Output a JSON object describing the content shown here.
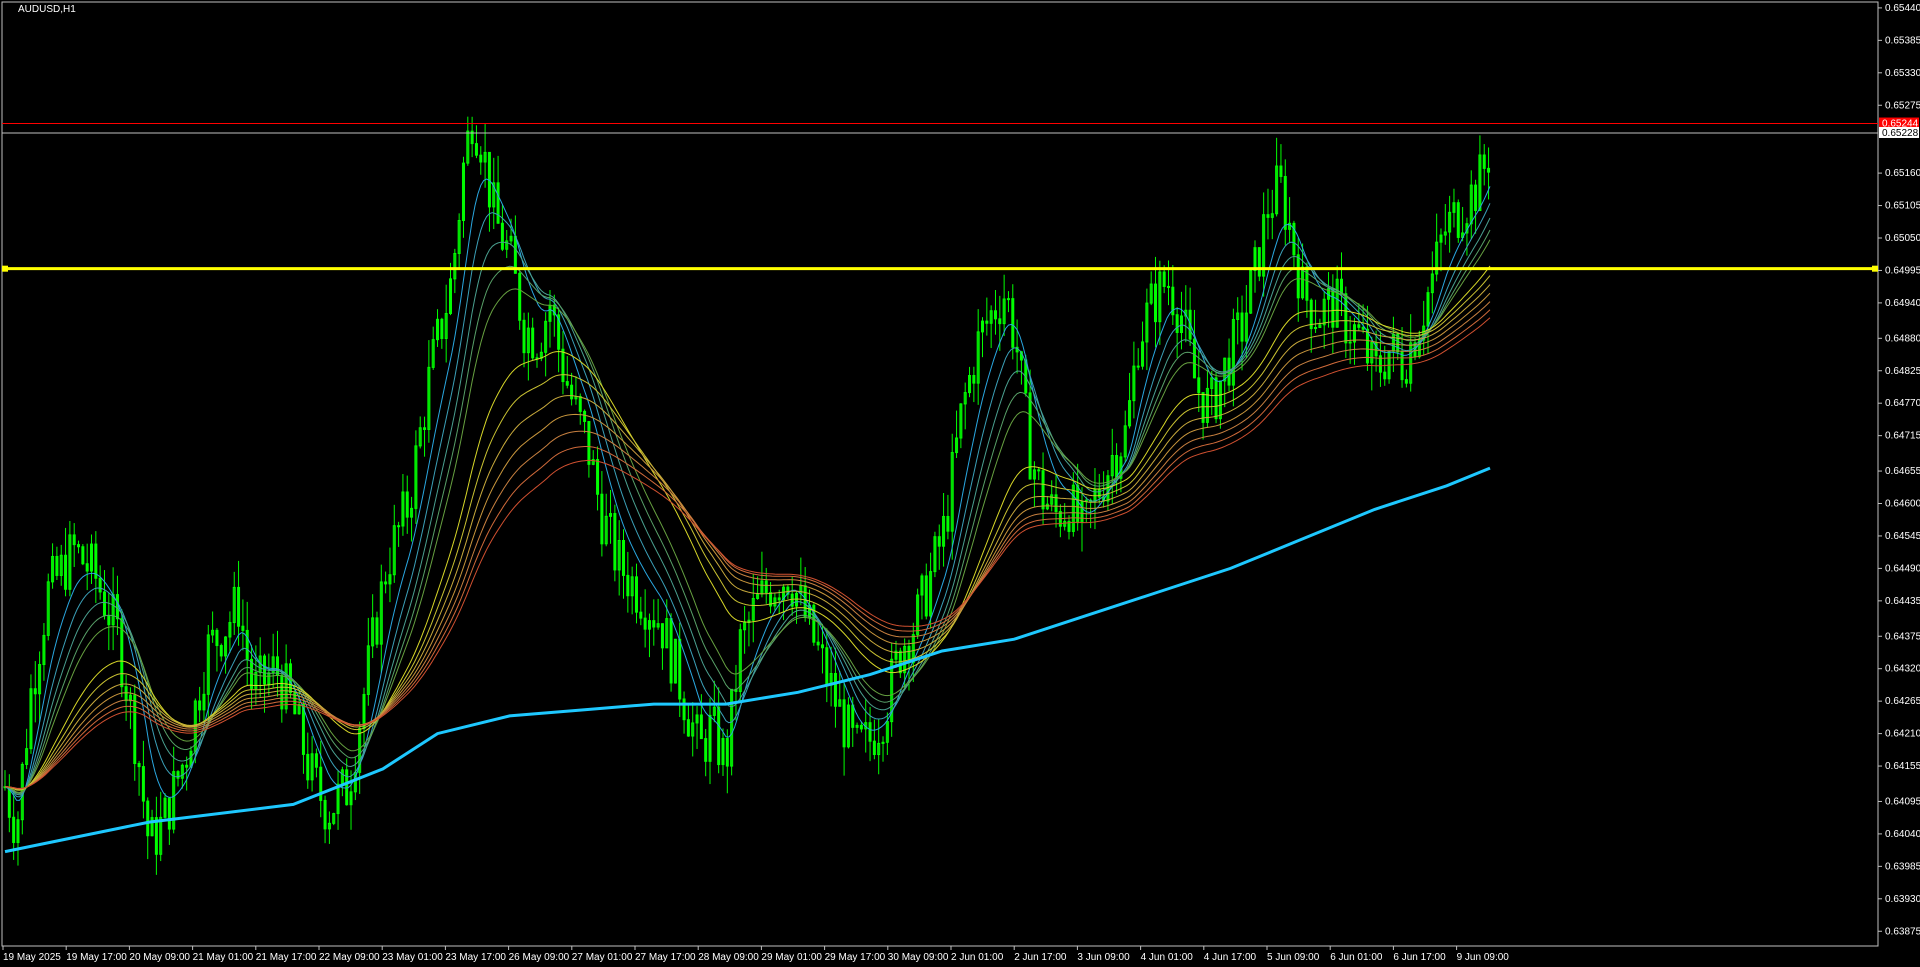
{
  "window": {
    "symbol_label": "AUDUSD,H1"
  },
  "colors": {
    "background": "#000000",
    "frame": "#c0c0c0",
    "candle": "#00ff00",
    "support_line": "#ffff00",
    "bid_line": "#c0c0c0",
    "ask_line": "#ff0000",
    "ema_slow": "#1ec8ff",
    "ema_fast_group": [
      "#2aa7e0",
      "#3ba0b8",
      "#4aa090",
      "#58a068",
      "#66a040"
    ],
    "ema_slow_group": [
      "#d7d728",
      "#c9c232",
      "#c8aa3c",
      "#c8963c",
      "#c88040",
      "#d06a3a",
      "#d05030"
    ],
    "text": "#ffffff"
  },
  "chart_data": {
    "type": "candlestick",
    "title": "AUDUSD,H1",
    "ylim": [
      0.6385,
      0.6545
    ],
    "y_ticks": [
      "0.65440",
      "0.65385",
      "0.65330",
      "0.65275",
      "0.65160",
      "0.65105",
      "0.65050",
      "0.64995",
      "0.64940",
      "0.64880",
      "0.64825",
      "0.64770",
      "0.64715",
      "0.64655",
      "0.64600",
      "0.64545",
      "0.64490",
      "0.64435",
      "0.64375",
      "0.64320",
      "0.64265",
      "0.64210",
      "0.64155",
      "0.64095",
      "0.64040",
      "0.63985",
      "0.63930",
      "0.63875"
    ],
    "x_ticks": [
      "19 May 2025",
      "19 May 17:00",
      "20 May 09:00",
      "21 May 01:00",
      "21 May 17:00",
      "22 May 09:00",
      "23 May 01:00",
      "23 May 17:00",
      "26 May 09:00",
      "27 May 01:00",
      "27 May 17:00",
      "28 May 09:00",
      "29 May 01:00",
      "29 May 17:00",
      "30 May 09:00",
      "2 Jun 01:00",
      "2 Jun 17:00",
      "3 Jun 09:00",
      "4 Jun 01:00",
      "4 Jun 17:00",
      "5 Jun 09:00",
      "6 Jun 01:00",
      "6 Jun 17:00",
      "9 Jun 09:00"
    ],
    "horizontal_lines": [
      {
        "name": "support-level",
        "value": 0.64998,
        "color": "#ffff00"
      },
      {
        "name": "ask-line",
        "value": 0.65244,
        "color": "#ff0000"
      },
      {
        "name": "bid-line",
        "value": 0.65228,
        "color": "#c0c0c0"
      }
    ],
    "price_tags": [
      {
        "label": "0.65244",
        "value": 0.65244,
        "bg": "#ff0000",
        "fg": "#ffffff"
      },
      {
        "label": "0.65228",
        "value": 0.65228,
        "bg": "#ffffff",
        "fg": "#000000"
      }
    ],
    "close_path": [
      [
        0,
        0.6412
      ],
      [
        8,
        0.6405
      ],
      [
        18,
        0.6428
      ],
      [
        30,
        0.6445
      ],
      [
        48,
        0.6452
      ],
      [
        62,
        0.6448
      ],
      [
        78,
        0.6438
      ],
      [
        92,
        0.6418
      ],
      [
        100,
        0.6402
      ],
      [
        110,
        0.6406
      ],
      [
        126,
        0.6418
      ],
      [
        140,
        0.6435
      ],
      [
        155,
        0.644
      ],
      [
        162,
        0.6443
      ],
      [
        172,
        0.6428
      ],
      [
        188,
        0.6432
      ],
      [
        200,
        0.6425
      ],
      [
        212,
        0.6414
      ],
      [
        224,
        0.6408
      ],
      [
        238,
        0.6412
      ],
      [
        252,
        0.6432
      ],
      [
        265,
        0.645
      ],
      [
        280,
        0.646
      ],
      [
        295,
        0.6482
      ],
      [
        310,
        0.6498
      ],
      [
        318,
        0.6517
      ],
      [
        324,
        0.6526
      ],
      [
        330,
        0.6522
      ],
      [
        340,
        0.6508
      ],
      [
        350,
        0.6502
      ],
      [
        360,
        0.649
      ],
      [
        370,
        0.6488
      ],
      [
        378,
        0.6494
      ],
      [
        386,
        0.6484
      ],
      [
        395,
        0.6476
      ],
      [
        404,
        0.647
      ],
      [
        414,
        0.6458
      ],
      [
        425,
        0.645
      ],
      [
        440,
        0.6445
      ],
      [
        455,
        0.644
      ],
      [
        470,
        0.6428
      ],
      [
        482,
        0.6418
      ],
      [
        490,
        0.6422
      ],
      [
        500,
        0.6416
      ],
      [
        510,
        0.6436
      ],
      [
        520,
        0.6442
      ],
      [
        530,
        0.6446
      ],
      [
        544,
        0.6448
      ],
      [
        556,
        0.644
      ],
      [
        568,
        0.6432
      ],
      [
        580,
        0.6424
      ],
      [
        590,
        0.6418
      ],
      [
        600,
        0.642
      ],
      [
        610,
        0.6425
      ],
      [
        622,
        0.6436
      ],
      [
        632,
        0.644
      ],
      [
        640,
        0.6446
      ],
      [
        652,
        0.6456
      ],
      [
        664,
        0.6476
      ],
      [
        676,
        0.6488
      ],
      [
        686,
        0.6493
      ],
      [
        694,
        0.6496
      ],
      [
        702,
        0.6486
      ],
      [
        710,
        0.647
      ],
      [
        718,
        0.6462
      ],
      [
        728,
        0.6458
      ],
      [
        738,
        0.646
      ],
      [
        748,
        0.6455
      ],
      [
        758,
        0.6462
      ],
      [
        768,
        0.6468
      ],
      [
        778,
        0.6472
      ],
      [
        786,
        0.6488
      ],
      [
        796,
        0.6494
      ],
      [
        806,
        0.6498
      ],
      [
        816,
        0.6492
      ],
      [
        826,
        0.648
      ],
      [
        836,
        0.6476
      ],
      [
        848,
        0.6484
      ],
      [
        858,
        0.649
      ],
      [
        868,
        0.65
      ],
      [
        876,
        0.651
      ],
      [
        884,
        0.6514
      ],
      [
        892,
        0.6506
      ],
      [
        900,
        0.6496
      ],
      [
        910,
        0.6492
      ],
      [
        922,
        0.6494
      ],
      [
        932,
        0.649
      ],
      [
        940,
        0.6488
      ],
      [
        950,
        0.6482
      ],
      [
        960,
        0.6486
      ],
      [
        970,
        0.6484
      ],
      [
        980,
        0.649
      ],
      [
        990,
        0.6498
      ],
      [
        998,
        0.6506
      ],
      [
        1010,
        0.651
      ],
      [
        1022,
        0.6514
      ],
      [
        1030,
        0.652
      ]
    ],
    "ema_slow_path": [
      [
        0,
        0.6401
      ],
      [
        100,
        0.6406
      ],
      [
        200,
        0.6409
      ],
      [
        262,
        0.6415
      ],
      [
        300,
        0.6421
      ],
      [
        350,
        0.6424
      ],
      [
        400,
        0.6425
      ],
      [
        450,
        0.6426
      ],
      [
        500,
        0.6426
      ],
      [
        550,
        0.6428
      ],
      [
        600,
        0.6431
      ],
      [
        650,
        0.6435
      ],
      [
        700,
        0.6437
      ],
      [
        750,
        0.6441
      ],
      [
        800,
        0.6445
      ],
      [
        850,
        0.6449
      ],
      [
        900,
        0.6454
      ],
      [
        950,
        0.6459
      ],
      [
        1000,
        0.6463
      ],
      [
        1030,
        0.6466
      ]
    ],
    "notes": "Values shown are read from axis ticks; candle index 0..1030 spans x-axis."
  }
}
